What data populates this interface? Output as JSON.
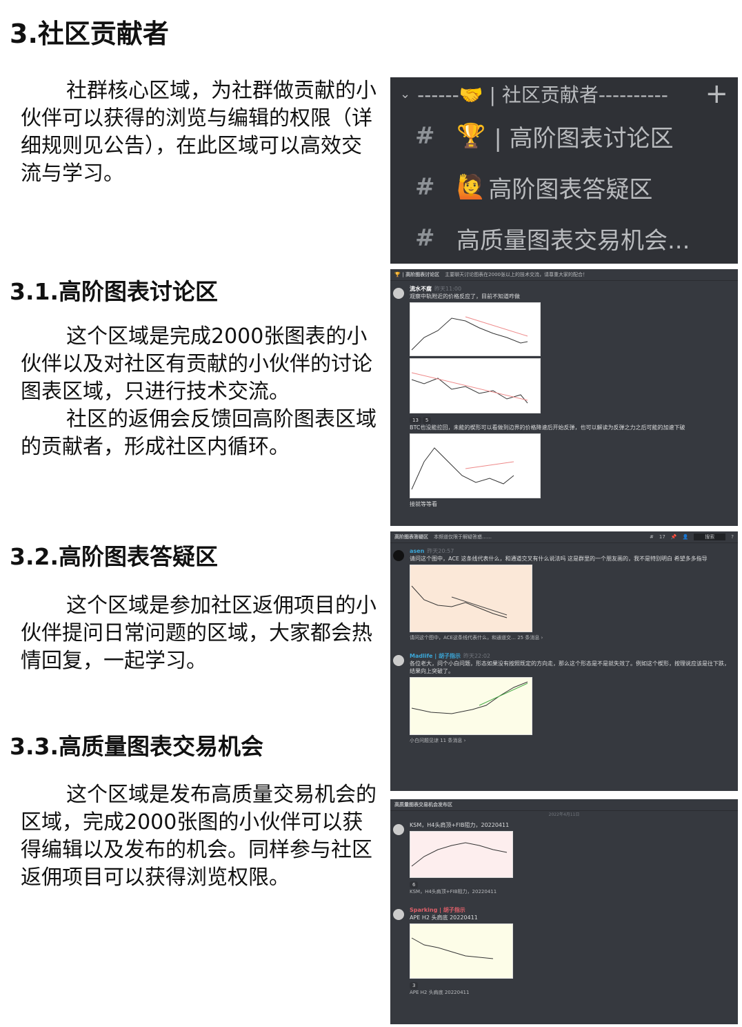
{
  "title": "3.社区贡献者",
  "intro": "社群核心区域，为社群做贡献的小伙伴可以获得的浏览与编辑的权限（详细规则见公告），在此区域可以高效交流与学习。",
  "sections": [
    {
      "heading": "3.1.高阶图表讨论区",
      "paragraphs": [
        "这个区域是完成2000张图表的小伙伴以及对社区有贡献的小伙伴的讨论图表区域，只进行技术交流。",
        "社区的返佣会反馈回高阶图表区域的贡献者，形成社区内循环。"
      ]
    },
    {
      "heading": "3.2.高阶图表答疑区",
      "paragraphs": [
        "这个区域是参加社区返佣项目的小伙伴提问日常问题的区域，大家都会热情回复，一起学习。"
      ]
    },
    {
      "heading": "3.3.高质量图表交易机会",
      "paragraphs": [
        "这个区域是发布高质量交易机会的区域，完成2000张图的小伙伴可以获得编辑以及发布的机会。同样参与社区返佣项目可以获得浏览权限。"
      ]
    }
  ],
  "channels": {
    "category": "------🤝 | 社区贡献者----------",
    "add": "+",
    "items": [
      {
        "icon": "🏆",
        "label": "| 高阶图表讨论区"
      },
      {
        "icon": "🙋",
        "label": "高阶图表答疑区"
      },
      {
        "icon": "",
        "label": "高质量图表交易机会..."
      }
    ]
  },
  "shot2": {
    "channel": "🏆 | 高阶图表讨论区",
    "topic": "主要聊天讨论图表在2000张以上的技术交流，请尊重大家的配合！",
    "user": "流水不腐",
    "time": "昨天11:00",
    "msg1": "观察中轨附近的价格反应了，目前不知道咋做",
    "reacts": [
      "13",
      "5"
    ],
    "msg2": "BTC也没能拉回，未能的楔形可以看做到边界的价格降速后开始反弹，也可以解读为反弹之力之后可能的加速下破",
    "msg3": "接就等等看"
  },
  "shot3": {
    "channel": "高阶图表答疑区",
    "topic": "本频道仅限于解疑答惑……",
    "count": "17",
    "search": "搜索",
    "user1": "asen",
    "time1": "昨天20:57",
    "msg1": "请问这个图中，ACE 这条线代表什么，和通道交叉有什么说法吗 这是群里的一个朋友画的，我不是特别明白 希望多多指导",
    "thread1": "请问这个图中，ACE这条线代表什么，和通道交… 25 条消息 ›",
    "user2": "Madlife | 胡子指示",
    "time2": "昨天22:02",
    "msg2": "各位老大，问个小白问题，形态如果没有按照既定的方向走，那么这个形态是不是就失效了。例如这个楔形，按理说应该是往下跌，结果向上突破了。",
    "thread2": "小白问题见谅 11 条消息 ›"
  },
  "shot4": {
    "channel": "高质量图表交易机会发布区",
    "date": "2022年4月11日",
    "msg1": "KSM，H4头肩顶+FIB阻力，20220411",
    "react1": "6",
    "thread1": "KSM，H4头肩顶+FIB阻力，20220411",
    "user2": "Sparking | 胡子指示",
    "msg2": "APE H2 头肩底 20220411",
    "react2": "3",
    "thread2": "APE H2 头肩底 20220411"
  }
}
